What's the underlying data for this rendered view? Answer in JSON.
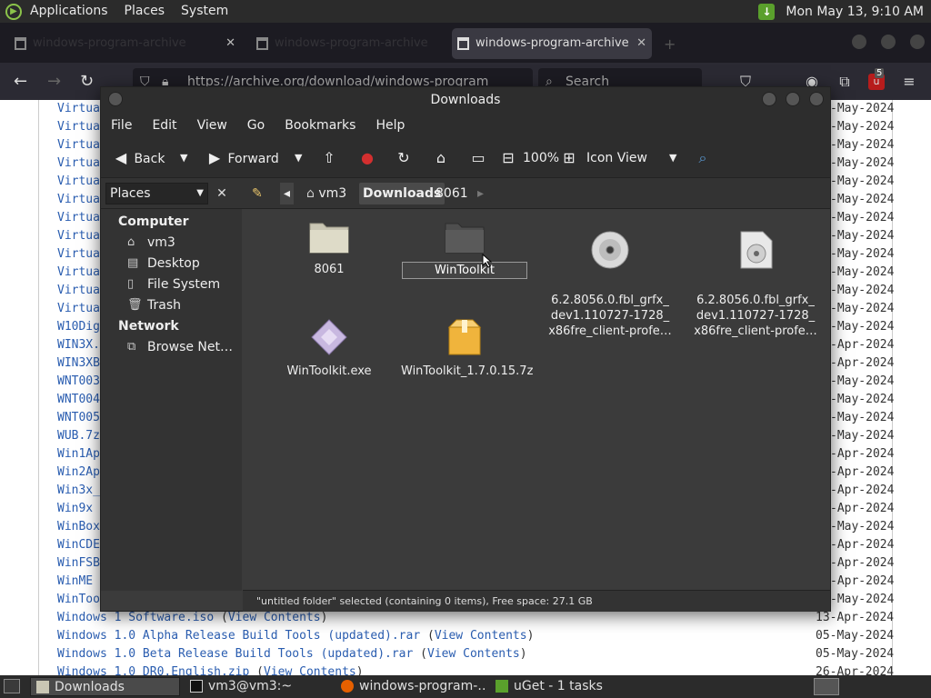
{
  "top_panel": {
    "menus": [
      "Applications",
      "Places",
      "System"
    ],
    "clock": "Mon May 13,  9:10 AM"
  },
  "firefox": {
    "tabs": [
      {
        "label": "windows-program-archive",
        "active": false
      },
      {
        "label": "windows-program-archive",
        "active": false
      },
      {
        "label": "windows-program-archive",
        "active": true
      }
    ],
    "url": "https://archive.org/download/windows-program",
    "search_placeholder": "Search",
    "ext_badge": "5"
  },
  "listing": {
    "rows_partial": [
      "Virtua",
      "Virtua",
      "Virtua",
      "Virtua",
      "Virtua",
      "Virtua",
      "Virtua",
      "Virtua",
      "Virtua",
      "Virtua",
      "Virtua",
      "Virtua",
      "W10Dig",
      "WIN3X.",
      "WIN3XB",
      "WNT003",
      "WNT004",
      "WNT005",
      "WUB.7z",
      "Win1Ap",
      "Win2Ap",
      "Win3x_",
      "Win9x ",
      "WinBox",
      "WinCDE",
      "WinFSB",
      "WinME ",
      "WinToo"
    ],
    "dates_partial": [
      "-May-2024",
      "-May-2024",
      "-May-2024",
      "-May-2024",
      "-May-2024",
      "-May-2024",
      "-May-2024",
      "-May-2024",
      "-May-2024",
      "-May-2024",
      "-May-2024",
      "-May-2024",
      "-May-2024",
      "-Apr-2024",
      "-Apr-2024",
      "-May-2024",
      "-May-2024",
      "-May-2024",
      "-May-2024",
      "-Apr-2024",
      "-Apr-2024",
      "-Apr-2024",
      "-Apr-2024",
      "-May-2024",
      "-Apr-2024",
      "-Apr-2024",
      "-Apr-2024",
      "-May-2024"
    ],
    "rows_full": [
      {
        "name": "Windows 1 Software.iso",
        "link": "View Contents",
        "date": "13-Apr-2024"
      },
      {
        "name": "Windows 1.0 Alpha Release Build Tools (updated).rar",
        "link": "View Contents",
        "date": "05-May-2024"
      },
      {
        "name": "Windows 1.0 Beta Release Build Tools (updated).rar",
        "link": "View Contents",
        "date": "05-May-2024"
      },
      {
        "name": "Windows 1.0 DR0.English.zip",
        "link": "View Contents",
        "date": "26-Apr-2024"
      }
    ]
  },
  "nautilus": {
    "title": "Downloads",
    "menus": [
      "File",
      "Edit",
      "View",
      "Go",
      "Bookmarks",
      "Help"
    ],
    "toolbar": {
      "back": "Back",
      "forward": "Forward",
      "zoom": "100%",
      "view_mode": "Icon View"
    },
    "places_combo": "Places",
    "crumbs": [
      "vm3",
      "Downloads",
      "8061"
    ],
    "sidebar": {
      "computer_header": "Computer",
      "computer_items": [
        "vm3",
        "Desktop",
        "File System",
        "Trash"
      ],
      "network_header": "Network",
      "network_items": [
        "Browse Net…"
      ]
    },
    "files": [
      {
        "name": "8061",
        "kind": "folder"
      },
      {
        "name": "WinToolkit",
        "kind": "folder-renaming"
      },
      {
        "name": "6.2.8056.0.fbl_grfx_\ndev1.110727-1728_\nx86fre_client-profe…",
        "kind": "disc"
      },
      {
        "name": "6.2.8056.0.fbl_grfx_\ndev1.110727-1728_\nx86fre_client-profe…",
        "kind": "disc-file"
      },
      {
        "name": "WinToolkit.exe",
        "kind": "exe"
      },
      {
        "name": "WinToolkit_1.7.0.15.7z",
        "kind": "archive"
      }
    ],
    "status": "\"untitled folder\" selected (containing 0 items), Free space: 27.1 GB"
  },
  "taskbar": {
    "tasks": [
      "Downloads",
      "vm3@vm3:~",
      "windows-program-…",
      "uGet - 1 tasks"
    ]
  }
}
